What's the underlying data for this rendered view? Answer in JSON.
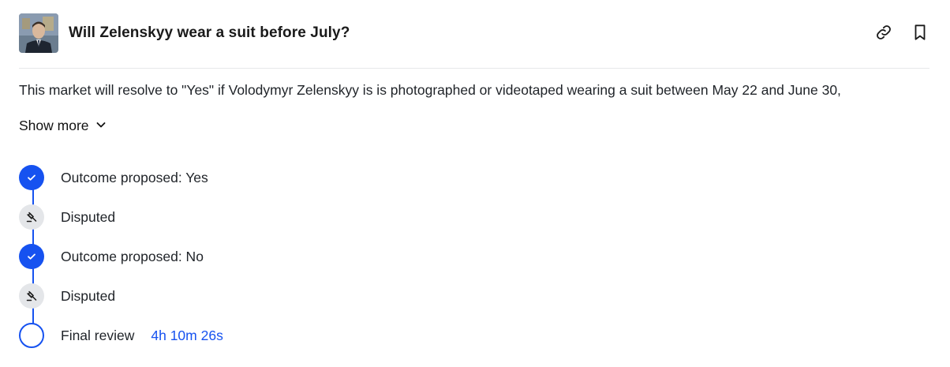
{
  "header": {
    "title": "Will Zelenskyy wear a suit before July?",
    "avatar_icon": "zelenskyy-photo",
    "actions": [
      {
        "name": "link-icon"
      },
      {
        "name": "bookmark-icon"
      }
    ]
  },
  "description": "This market will resolve to \"Yes\" if Volodymyr Zelenskyy is is photographed or videotaped wearing a suit between May 22 and June 30,",
  "show_more_label": "Show more",
  "timeline": {
    "accent_color": "#1652f0",
    "steps": [
      {
        "status": "done",
        "label": "Outcome proposed: Yes"
      },
      {
        "status": "disputed",
        "label": "Disputed"
      },
      {
        "status": "done",
        "label": "Outcome proposed: No"
      },
      {
        "status": "disputed",
        "label": "Disputed"
      },
      {
        "status": "pending",
        "label": "Final review",
        "timer": "4h 10m 26s"
      }
    ]
  }
}
